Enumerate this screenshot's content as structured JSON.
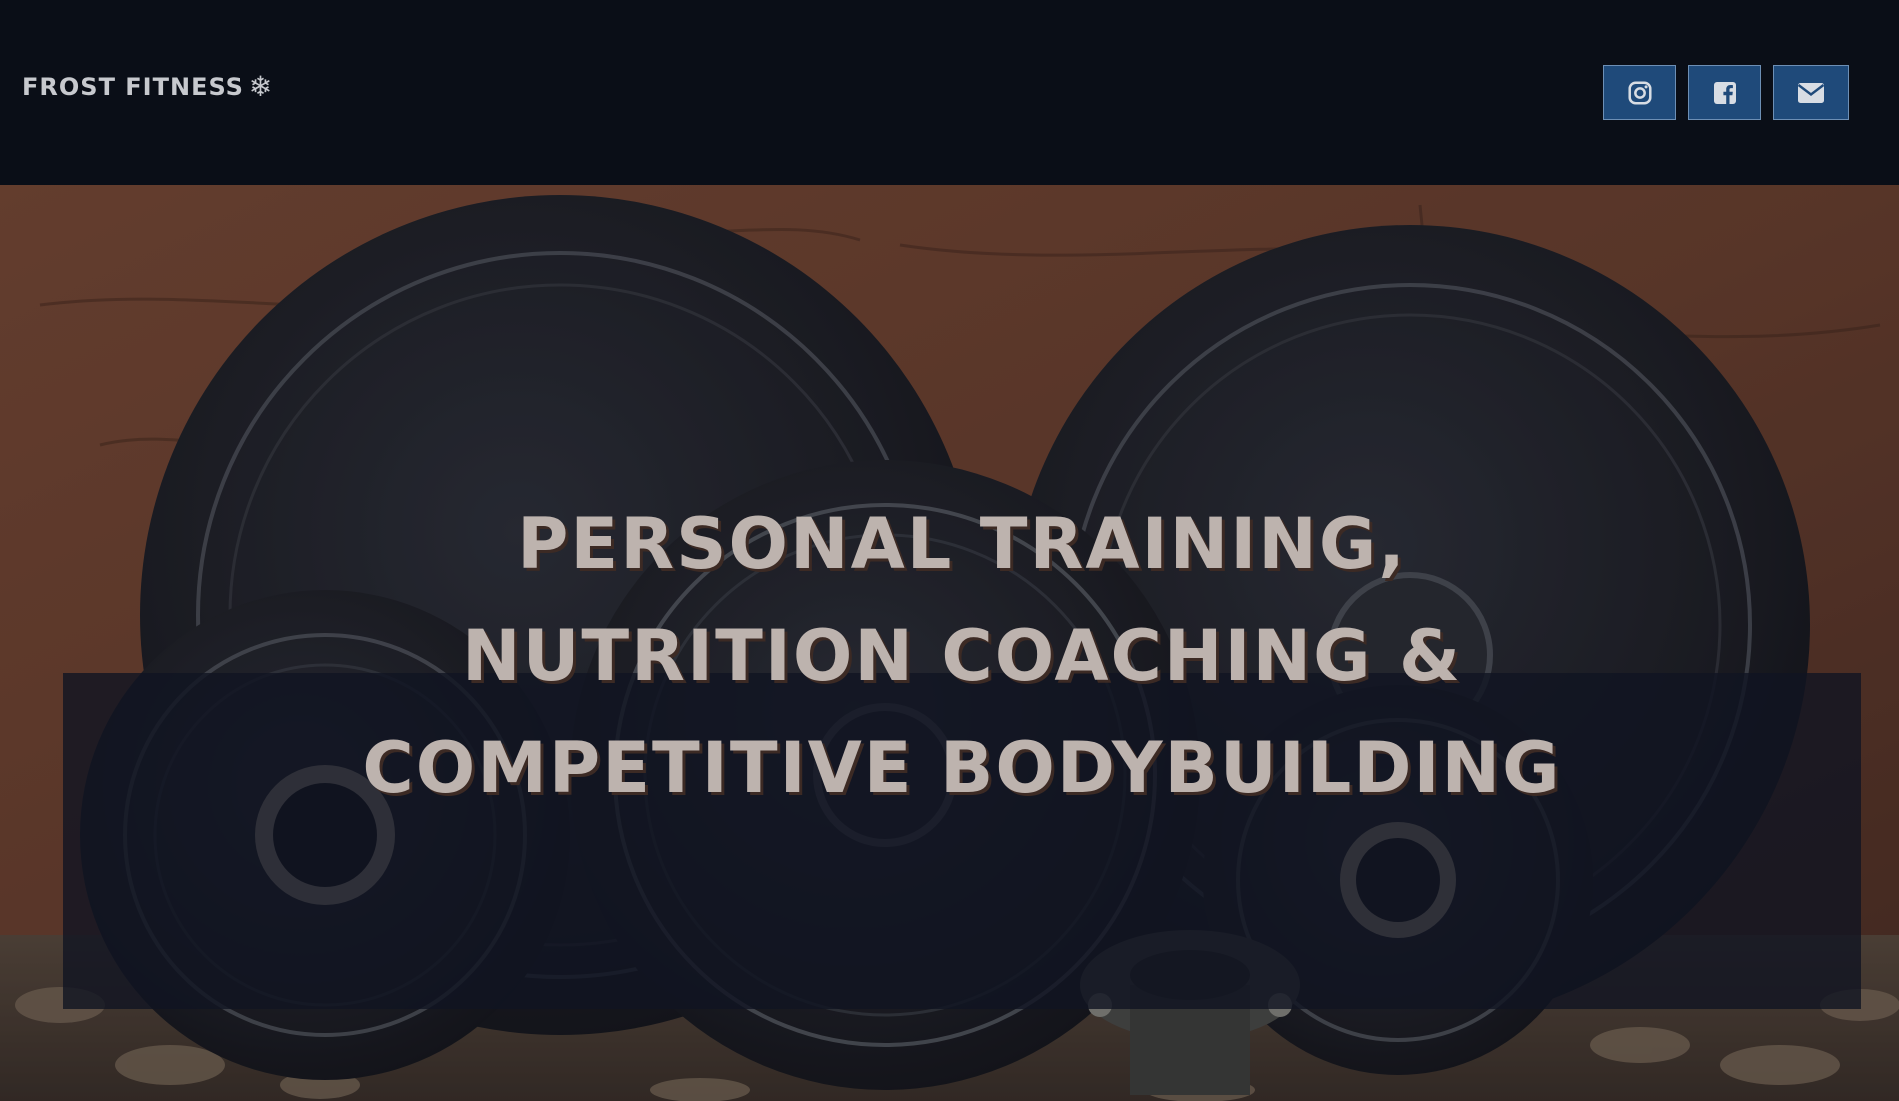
{
  "header": {
    "logo_text": "FROST FITNESS",
    "logo_icon": "snowflake-icon",
    "social": [
      {
        "name": "instagram",
        "icon": "instagram-icon"
      },
      {
        "name": "facebook",
        "icon": "facebook-icon"
      },
      {
        "name": "email",
        "icon": "envelope-icon"
      }
    ]
  },
  "hero": {
    "background": "weight-plates-photo",
    "headline_lines": [
      "PERSONAL TRAINING,",
      "NUTRITION COACHING &",
      "COMPETITIVE BODYBUILDING"
    ]
  },
  "colors": {
    "header_bg": "#0a0e17",
    "button_bg": "#1f4a7a",
    "button_border": "#6d8fb5",
    "headline_text": "#bdb3ae",
    "banner_bg": "#101422"
  }
}
